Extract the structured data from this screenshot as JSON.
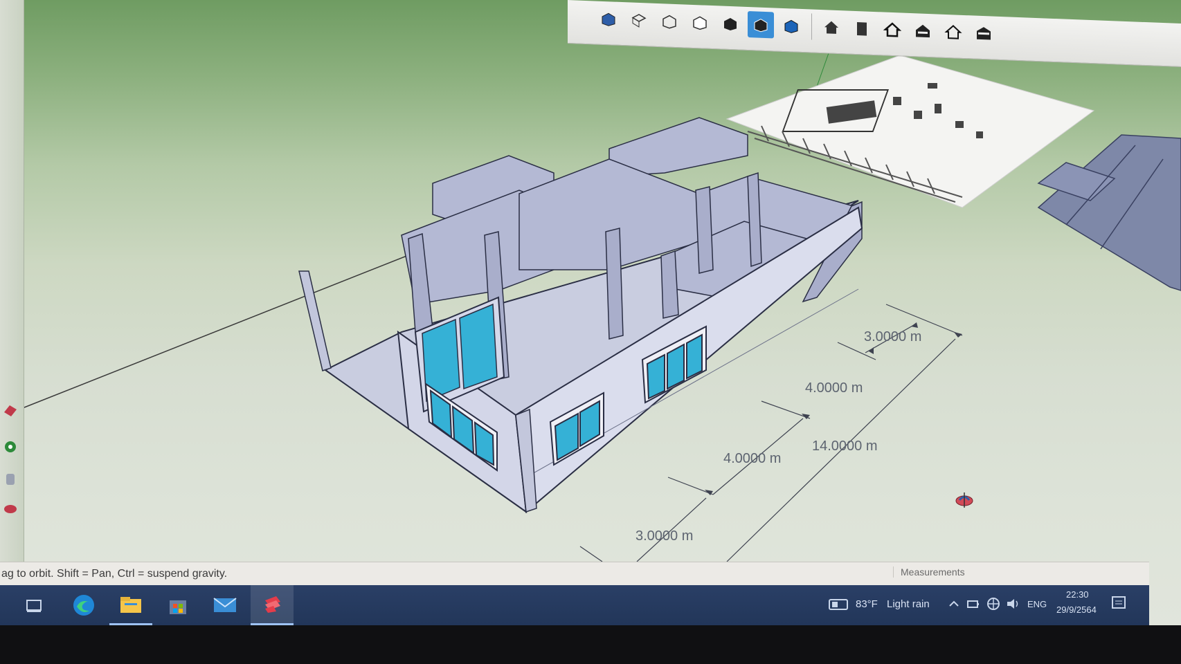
{
  "toolbar": {
    "buttons": [
      {
        "name": "house-style-1-icon",
        "active": false
      },
      {
        "name": "house-style-2-icon",
        "active": false
      },
      {
        "name": "house-style-3-icon",
        "active": false
      },
      {
        "name": "house-style-4-icon",
        "active": false
      },
      {
        "name": "house-style-5-icon",
        "active": false
      },
      {
        "name": "house-style-6-icon",
        "active": true
      },
      {
        "name": "house-style-7-icon",
        "active": false
      }
    ]
  },
  "viewport": {
    "dimensions": {
      "d1": "3.0000 m",
      "d2": "4.0000 m",
      "d3": "14.0000 m",
      "d4": "4.0000 m",
      "d5": "3.0000 m"
    }
  },
  "status": {
    "hint": "ag to orbit. Shift = Pan, Ctrl = suspend gravity.",
    "measurements_label": "Measurements"
  },
  "taskbar": {
    "weather_temp": "83°F",
    "weather_desc": "Light rain",
    "lang": "ENG",
    "time": "22:30",
    "date": "29/9/2564"
  },
  "colors": {
    "sky": "#6f9c62",
    "ground": "#dde3d8",
    "wall": "#c6cbe3",
    "glass": "#35b1d6",
    "accent": "#3a8ed6"
  }
}
